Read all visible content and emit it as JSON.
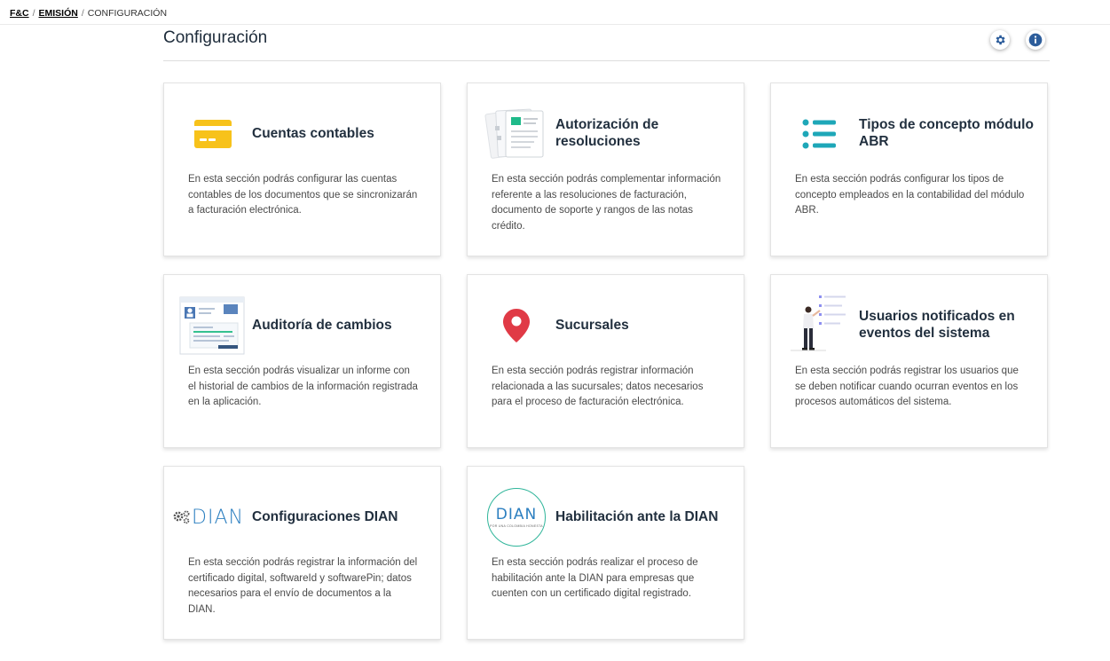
{
  "breadcrumb": {
    "home": "F&C",
    "section": "EMISIÓN",
    "current": "CONFIGURACIÓN",
    "separator": "/"
  },
  "page": {
    "title": "Configuración"
  },
  "header_actions": {
    "settings_icon": "gear-icon",
    "info_icon": "info-icon",
    "accent_color": "#2d5d9b"
  },
  "cards": [
    {
      "title": "Cuentas contables",
      "description": "En esta sección podrás configurar las cuentas contables de los documentos que se sincronizarán a facturación electrónica.",
      "icon": "credit-card-icon"
    },
    {
      "title": "Autorización de resoluciones",
      "description": "En esta sección podrás complementar información referente a las resoluciones de facturación, documento de soporte y rangos de las notas crédito.",
      "icon": "documents-illustration"
    },
    {
      "title": "Tipos de concepto módulo ABR",
      "description": "En esta sección podrás configurar los tipos de concepto empleados en la contabilidad del módulo ABR.",
      "icon": "list-icon"
    },
    {
      "title": "Auditoría de cambios",
      "description": "En esta sección podrás visualizar un informe con el historial de cambios de la información registrada en la aplicación.",
      "icon": "audit-illustration"
    },
    {
      "title": "Sucursales",
      "description": "En esta sección podrás registrar información relacionada a las sucursales; datos necesarios para el proceso de facturación electrónica.",
      "icon": "map-pin-icon"
    },
    {
      "title": "Usuarios notificados en eventos del sistema",
      "description": "En esta sección podrás registrar los usuarios que se deben notificar cuando ocurran eventos en los procesos automáticos del sistema.",
      "icon": "person-checklist-illustration"
    },
    {
      "title": "Configuraciones DIAN",
      "description": "En esta sección podrás registrar la información del certificado digital, softwareId y softwarePin; datos necesarios para el envío de documentos a la DIAN.",
      "icon": "dian-gears-logo",
      "logo_text": "DIAN"
    },
    {
      "title": "Habilitación ante la DIAN",
      "description": "En esta sección podrás realizar el proceso de habilitación ante la DIAN para empresas que cuenten con un certificado digital registrado.",
      "icon": "dian-circle-logo",
      "logo_text": "DIAN",
      "logo_subtext": "POR UNA COLOMBIA HONESTA"
    }
  ]
}
